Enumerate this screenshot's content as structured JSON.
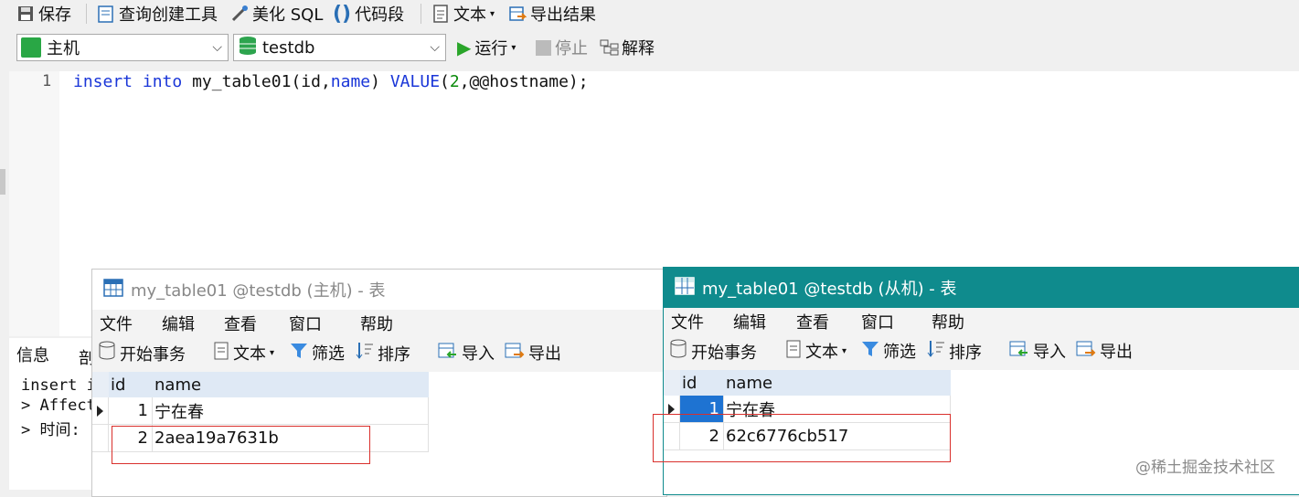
{
  "toolbar": {
    "save": "保存",
    "query_builder": "查询创建工具",
    "beautify_sql": "美化 SQL",
    "code_snippet": "代码段",
    "text": "文本",
    "export_results": "导出结果",
    "run": "运行",
    "stop": "停止",
    "explain": "解释"
  },
  "connection_combo": {
    "value": "主机"
  },
  "database_combo": {
    "value": "testdb"
  },
  "editor": {
    "line_number": "1",
    "tokens": {
      "t1": "insert",
      "t2": " ",
      "t3": "into",
      "t4": " my_table01(id,",
      "t5": "name",
      "t6": ") ",
      "t7": "VALUE",
      "t8": "(",
      "t9": "2",
      "t10": ",@@hostname);"
    }
  },
  "info_panel": {
    "tab_info": "信息",
    "tab_partial": "剖",
    "line1": "insert i",
    "line2": "> Affect",
    "line3": "> 时间:"
  },
  "window_master": {
    "title": "my_table01 @testdb (主机) - 表",
    "menu": [
      "文件",
      "编辑",
      "查看",
      "窗口",
      "帮助"
    ],
    "tools": {
      "begin_tx": "开始事务",
      "text": "文本",
      "filter": "筛选",
      "sort": "排序",
      "import": "导入",
      "export": "导出"
    },
    "columns": [
      "id",
      "name"
    ],
    "rows": [
      {
        "id": "1",
        "name": "宁在春"
      },
      {
        "id": "2",
        "name": "2aea19a7631b"
      }
    ]
  },
  "window_slave": {
    "title": "my_table01 @testdb (从机) - 表",
    "title_bg": "#0f8b8d",
    "menu": [
      "文件",
      "编辑",
      "查看",
      "窗口",
      "帮助"
    ],
    "tools": {
      "begin_tx": "开始事务",
      "text": "文本",
      "filter": "筛选",
      "sort": "排序",
      "import": "导入",
      "export": "导出"
    },
    "columns": [
      "id",
      "name"
    ],
    "rows": [
      {
        "id": "1",
        "name": "宁在春"
      },
      {
        "id": "2",
        "name": "62c6776cb517"
      }
    ]
  },
  "watermark": "@稀土掘金技术社区"
}
